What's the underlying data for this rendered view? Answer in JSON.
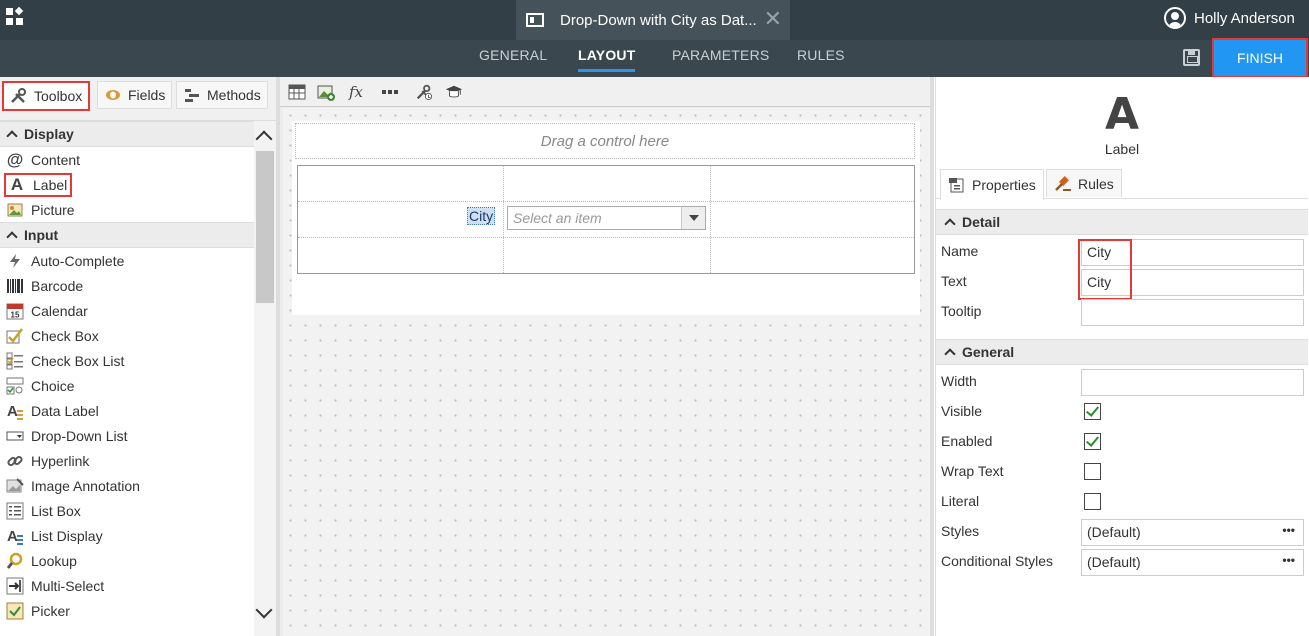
{
  "header": {
    "document_title": "Drop-Down with City as Dat...",
    "user_name": "Holly Anderson",
    "tabs": [
      "GENERAL",
      "LAYOUT",
      "PARAMETERS",
      "RULES"
    ],
    "active_tab": "LAYOUT",
    "finish_label": "FINISH"
  },
  "left_panel": {
    "tabs": [
      "Toolbox",
      "Fields",
      "Methods"
    ],
    "groups": [
      {
        "label": "Display",
        "items": [
          "Content",
          "Label",
          "Picture"
        ]
      },
      {
        "label": "Input",
        "items": [
          "Auto-Complete",
          "Barcode",
          "Calendar",
          "Check Box",
          "Check Box List",
          "Choice",
          "Data Label",
          "Drop-Down List",
          "Hyperlink",
          "Image Annotation",
          "List Box",
          "List Display",
          "Lookup",
          "Multi-Select",
          "Picker"
        ]
      }
    ]
  },
  "canvas": {
    "drop_hint": "Drag a control here",
    "label_text": "City",
    "select_placeholder": "Select an item",
    "toolbar_icons": [
      "table-icon",
      "image-add-icon",
      "fx-icon",
      "dots-icon",
      "tools-icon",
      "hat-icon"
    ]
  },
  "right_panel": {
    "control_icon_glyph": "A",
    "control_type": "Label",
    "tabs": [
      "Properties",
      "Rules"
    ],
    "sections": {
      "detail": "Detail",
      "general": "General"
    },
    "properties": {
      "name_label": "Name",
      "name_value": "City",
      "text_label": "Text",
      "text_value": "City",
      "tooltip_label": "Tooltip",
      "tooltip_value": "",
      "width_label": "Width",
      "width_value": "",
      "visible_label": "Visible",
      "visible": true,
      "enabled_label": "Enabled",
      "enabled": true,
      "wrap_label": "Wrap Text",
      "wrap": false,
      "literal_label": "Literal",
      "literal": false,
      "styles_label": "Styles",
      "styles_value": "(Default)",
      "cond_styles_label": "Conditional Styles",
      "cond_styles_value": "(Default)"
    }
  },
  "colors": {
    "topbar": "#333f47",
    "accent": "#2196f3",
    "highlight_border": "#e53935"
  }
}
